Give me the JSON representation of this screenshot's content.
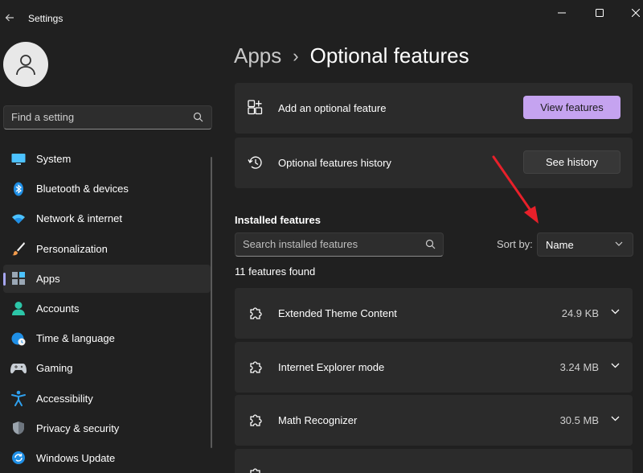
{
  "window": {
    "title": "Settings"
  },
  "sidebar": {
    "search_placeholder": "Find a setting",
    "items": [
      {
        "label": "System",
        "icon": "monitor-icon"
      },
      {
        "label": "Bluetooth & devices",
        "icon": "bluetooth-icon"
      },
      {
        "label": "Network & internet",
        "icon": "wifi-icon"
      },
      {
        "label": "Personalization",
        "icon": "brush-icon"
      },
      {
        "label": "Apps",
        "icon": "apps-icon",
        "active": true
      },
      {
        "label": "Accounts",
        "icon": "person-icon"
      },
      {
        "label": "Time & language",
        "icon": "globe-clock-icon"
      },
      {
        "label": "Gaming",
        "icon": "gamepad-icon"
      },
      {
        "label": "Accessibility",
        "icon": "accessibility-icon"
      },
      {
        "label": "Privacy & security",
        "icon": "shield-icon"
      },
      {
        "label": "Windows Update",
        "icon": "update-icon"
      }
    ]
  },
  "main": {
    "breadcrumb": {
      "parent": "Apps",
      "separator": "›",
      "current": "Optional features"
    },
    "add_card": {
      "label": "Add an optional feature",
      "button": "View features"
    },
    "history_card": {
      "label": "Optional features history",
      "button": "See history"
    },
    "installed": {
      "heading": "Installed features",
      "search_placeholder": "Search installed features",
      "sort_label": "Sort by:",
      "sort_value": "Name",
      "count_text": "11 features found",
      "features": [
        {
          "name": "Extended Theme Content",
          "size": "24.9 KB"
        },
        {
          "name": "Internet Explorer mode",
          "size": "3.24 MB"
        },
        {
          "name": "Math Recognizer",
          "size": "30.5 MB"
        }
      ]
    }
  },
  "colors": {
    "background": "#202020",
    "card": "#2b2b2b",
    "accent_button": "#c5a3f0",
    "annotation_arrow": "#e8202a"
  }
}
